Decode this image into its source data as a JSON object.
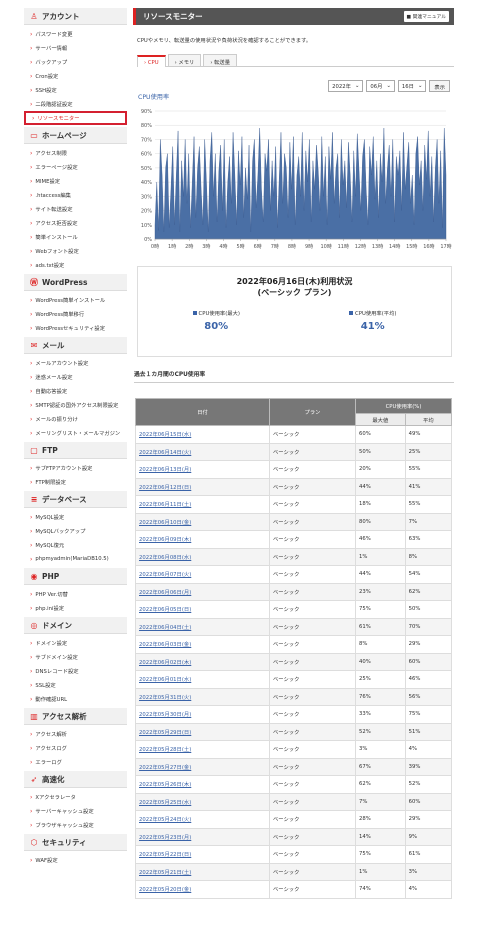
{
  "sidebar": [
    {
      "title": "アカウント",
      "icon": "user-icon",
      "items": [
        "パスワード変更",
        "サーバー情報",
        "バックアップ",
        "Cron設定",
        "SSH設定",
        "二段階認証設定",
        "リソースモニター"
      ]
    },
    {
      "title": "ホームページ",
      "icon": "window-icon",
      "items": [
        "アクセス制限",
        "エラーページ設定",
        "MIME設定",
        ".htaccess編集",
        "サイト転送設定",
        "アクセス拒否設定",
        "簡単インストール",
        "Webフォント設定",
        "ads.txt設定"
      ]
    },
    {
      "title": "WordPress",
      "icon": "wordpress-icon",
      "items": [
        "WordPress簡単インストール",
        "WordPress簡単移行",
        "WordPressセキュリティ設定"
      ]
    },
    {
      "title": "メール",
      "icon": "mail-icon",
      "items": [
        "メールアカウント設定",
        "迷惑メール設定",
        "自動応答設定",
        "SMTP認証の国外アクセス制限設定",
        "メールの振り分け",
        "メーリングリスト・メールマガジン"
      ]
    },
    {
      "title": "FTP",
      "icon": "monitor-icon",
      "items": [
        "サブFTPアカウント設定",
        "FTP制限設定"
      ]
    },
    {
      "title": "データベース",
      "icon": "database-icon",
      "items": [
        "MySQL設定",
        "MySQLバックアップ",
        "MySQL復元",
        "phpmyadmin(MariaDB10.5)"
      ]
    },
    {
      "title": "PHP",
      "icon": "php-icon",
      "items": [
        "PHP Ver.切替",
        "php.ini設定"
      ]
    },
    {
      "title": "ドメイン",
      "icon": "globe-icon",
      "items": [
        "ドメイン設定",
        "サブドメイン設定",
        "DNSレコード設定",
        "SSL設定",
        "動作確認URL"
      ]
    },
    {
      "title": "アクセス解析",
      "icon": "bar-chart-icon",
      "items": [
        "アクセス解析",
        "アクセスログ",
        "エラーログ"
      ]
    },
    {
      "title": "高速化",
      "icon": "rocket-icon",
      "items": [
        "Xアクセラレータ",
        "サーバーキャッシュ設定",
        "ブラウザキャッシュ設定"
      ]
    },
    {
      "title": "セキュリティ",
      "icon": "shield-icon",
      "items": [
        "WAF設定"
      ]
    }
  ],
  "active_item": "リソースモニター",
  "header": {
    "title": "リソースモニター",
    "manual": "関連マニュアル"
  },
  "description": "CPUやメモリ、転送量の使用状況や負荷状況を確認することができます。",
  "tabs": [
    "CPU",
    "メモリ",
    "転送量"
  ],
  "date_select": {
    "year": "2022年",
    "month": "06月",
    "day": "16日",
    "button": "表示"
  },
  "chart_data": {
    "type": "area",
    "title": "CPU使用率",
    "x_ticks": [
      "0時",
      "1時",
      "2時",
      "3時",
      "4時",
      "5時",
      "6時",
      "7時",
      "8時",
      "9時",
      "10時",
      "11時",
      "12時",
      "13時",
      "14時",
      "15時",
      "16時",
      "17時"
    ],
    "y_ticks": [
      "0%",
      "10%",
      "20%",
      "30%",
      "40%",
      "50%",
      "60%",
      "70%",
      "80%",
      "90%"
    ],
    "ylim": [
      0,
      90
    ],
    "color": "#4a6fa5",
    "values": [
      10,
      40,
      6,
      70,
      45,
      5,
      50,
      60,
      8,
      35,
      65,
      10,
      45,
      76,
      5,
      55,
      30,
      70,
      25,
      60,
      8,
      40,
      72,
      15,
      50,
      65,
      35,
      10,
      70,
      40,
      5,
      55,
      75,
      30,
      60,
      12,
      48,
      66,
      20,
      70,
      8,
      40,
      58,
      25,
      75,
      45,
      10,
      62,
      38,
      72,
      15,
      50,
      28,
      66,
      5,
      55,
      70,
      22,
      45,
      78,
      35,
      12,
      60,
      48,
      70,
      20,
      55,
      30,
      65,
      8,
      42,
      75,
      25,
      60,
      50,
      15,
      68,
      35,
      72,
      10,
      45,
      58,
      30,
      75,
      20,
      62,
      40,
      70,
      12,
      55,
      35,
      66,
      48,
      20,
      72,
      30,
      58,
      10,
      65,
      42,
      75,
      25,
      50,
      60,
      15,
      70,
      38,
      55,
      22,
      68,
      45,
      12,
      62,
      30,
      74,
      48,
      20,
      58,
      70,
      35,
      10,
      65,
      45,
      72,
      28,
      55,
      15,
      60,
      40,
      78,
      25,
      50,
      66,
      30,
      70,
      12,
      58,
      45,
      62,
      20,
      75,
      35,
      52,
      68,
      25,
      45,
      10,
      60,
      72,
      38,
      55,
      20,
      66,
      42,
      76,
      30,
      58,
      12,
      50,
      70,
      25,
      62,
      8,
      78,
      45
    ]
  },
  "summary": {
    "title": "2022年06月16日(木)利用状況",
    "plan": "(ベーシック プラン)",
    "max_label": "CPU使用率(最大)",
    "max_value": "80%",
    "avg_label": "CPU使用率(平均)",
    "avg_value": "41%"
  },
  "table_title": "過去１カ月間のCPU使用率",
  "table": {
    "h_date": "日付",
    "h_plan": "プラン",
    "h_cpu": "CPU使用率(%)",
    "h_max": "最大値",
    "h_avg": "平均",
    "rows": [
      [
        "2022年06月15日(水)",
        "ベーシック",
        "60%",
        "49%"
      ],
      [
        "2022年06月14日(火)",
        "ベーシック",
        "50%",
        "25%"
      ],
      [
        "2022年06月13日(月)",
        "ベーシック",
        "20%",
        "55%"
      ],
      [
        "2022年06月12日(日)",
        "ベーシック",
        "44%",
        "41%"
      ],
      [
        "2022年06月11日(土)",
        "ベーシック",
        "18%",
        "55%"
      ],
      [
        "2022年06月10日(金)",
        "ベーシック",
        "80%",
        "7%"
      ],
      [
        "2022年06月09日(木)",
        "ベーシック",
        "46%",
        "63%"
      ],
      [
        "2022年06月08日(水)",
        "ベーシック",
        "1%",
        "8%"
      ],
      [
        "2022年06月07日(火)",
        "ベーシック",
        "44%",
        "54%"
      ],
      [
        "2022年06月06日(月)",
        "ベーシック",
        "23%",
        "62%"
      ],
      [
        "2022年06月05日(日)",
        "ベーシック",
        "75%",
        "50%"
      ],
      [
        "2022年06月04日(土)",
        "ベーシック",
        "61%",
        "70%"
      ],
      [
        "2022年06月03日(金)",
        "ベーシック",
        "8%",
        "29%"
      ],
      [
        "2022年06月02日(木)",
        "ベーシック",
        "40%",
        "60%"
      ],
      [
        "2022年06月01日(水)",
        "ベーシック",
        "25%",
        "46%"
      ],
      [
        "2022年05月31日(火)",
        "ベーシック",
        "76%",
        "56%"
      ],
      [
        "2022年05月30日(月)",
        "ベーシック",
        "33%",
        "75%"
      ],
      [
        "2022年05月29日(日)",
        "ベーシック",
        "52%",
        "51%"
      ],
      [
        "2022年05月28日(土)",
        "ベーシック",
        "3%",
        "4%"
      ],
      [
        "2022年05月27日(金)",
        "ベーシック",
        "67%",
        "39%"
      ],
      [
        "2022年05月26日(木)",
        "ベーシック",
        "62%",
        "52%"
      ],
      [
        "2022年05月25日(水)",
        "ベーシック",
        "7%",
        "60%"
      ],
      [
        "2022年05月24日(火)",
        "ベーシック",
        "28%",
        "29%"
      ],
      [
        "2022年05月23日(月)",
        "ベーシック",
        "14%",
        "9%"
      ],
      [
        "2022年05月22日(日)",
        "ベーシック",
        "75%",
        "61%"
      ],
      [
        "2022年05月21日(土)",
        "ベーシック",
        "1%",
        "3%"
      ],
      [
        "2022年05月20日(金)",
        "ベーシック",
        "74%",
        "4%"
      ]
    ]
  }
}
